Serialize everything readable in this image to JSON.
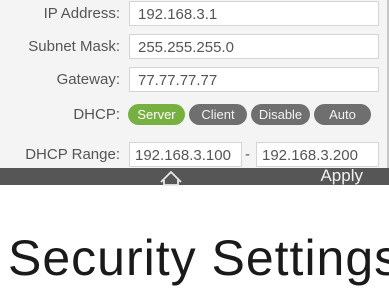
{
  "network": {
    "ip_label": "IP Address:",
    "ip_value": "192.168.3.1",
    "mask_label": "Subnet Mask:",
    "mask_value": "255.255.255.0",
    "gateway_label": "Gateway:",
    "gateway_value": "77.77.77.77",
    "dhcp_label": "DHCP:",
    "dhcp_options": [
      "Server",
      "Client",
      "Disable",
      "Auto"
    ],
    "dhcp_selected": "Server",
    "range_label": "DHCP Range:",
    "range_start": "192.168.3.100",
    "range_separator": "-",
    "range_end": "192.168.3.200"
  },
  "toolbar": {
    "home_icon": "home-icon",
    "apply_label": "Apply"
  },
  "section": {
    "title": "Security Settings"
  },
  "colors": {
    "active_pill": "#76b041",
    "inactive_pill": "#6f6f6f",
    "toolbar": "#565656"
  }
}
